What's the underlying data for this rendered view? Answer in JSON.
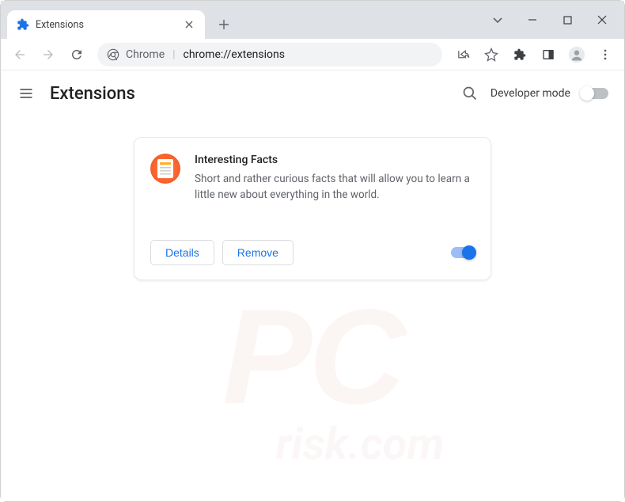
{
  "tab": {
    "title": "Extensions"
  },
  "omnibox": {
    "prefix": "Chrome",
    "url": "chrome://extensions"
  },
  "page": {
    "title": "Extensions",
    "dev_mode_label": "Developer mode"
  },
  "extension": {
    "name": "Interesting Facts",
    "description": "Short and rather curious facts that will allow you to learn a little new about everything in the world.",
    "details_label": "Details",
    "remove_label": "Remove",
    "enabled": true
  },
  "watermark": {
    "main": "PC",
    "sub": "risk.com"
  }
}
